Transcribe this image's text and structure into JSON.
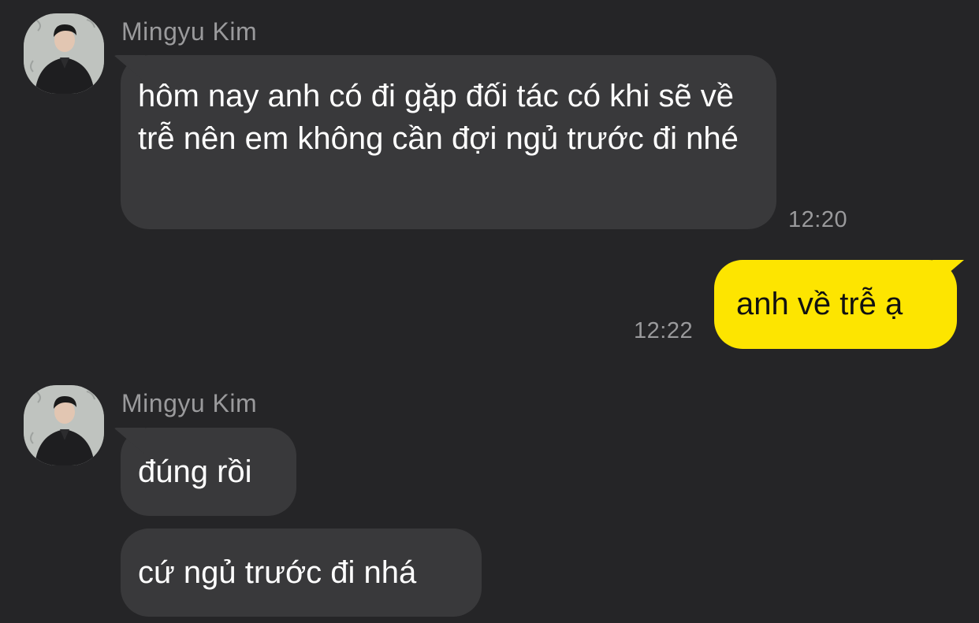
{
  "messages": [
    {
      "sender": "Mingyu Kim",
      "text": "hôm nay anh có đi gặp đối tác có khi sẽ về trễ nên em không cần đợi ngủ trước đi nhé",
      "time": "12:20"
    },
    {
      "from_me": true,
      "text": "anh về trễ ạ",
      "time": "12:22"
    },
    {
      "sender": "Mingyu Kim",
      "text": "đúng rồi"
    },
    {
      "text": "cứ ngủ trước đi nhá"
    }
  ],
  "colors": {
    "background": "#252527",
    "incoming_bubble": "#39393b",
    "outgoing_bubble": "#fde500",
    "secondary_text": "#9a9a9c"
  },
  "icons": {
    "avatar": "profile-photo"
  }
}
